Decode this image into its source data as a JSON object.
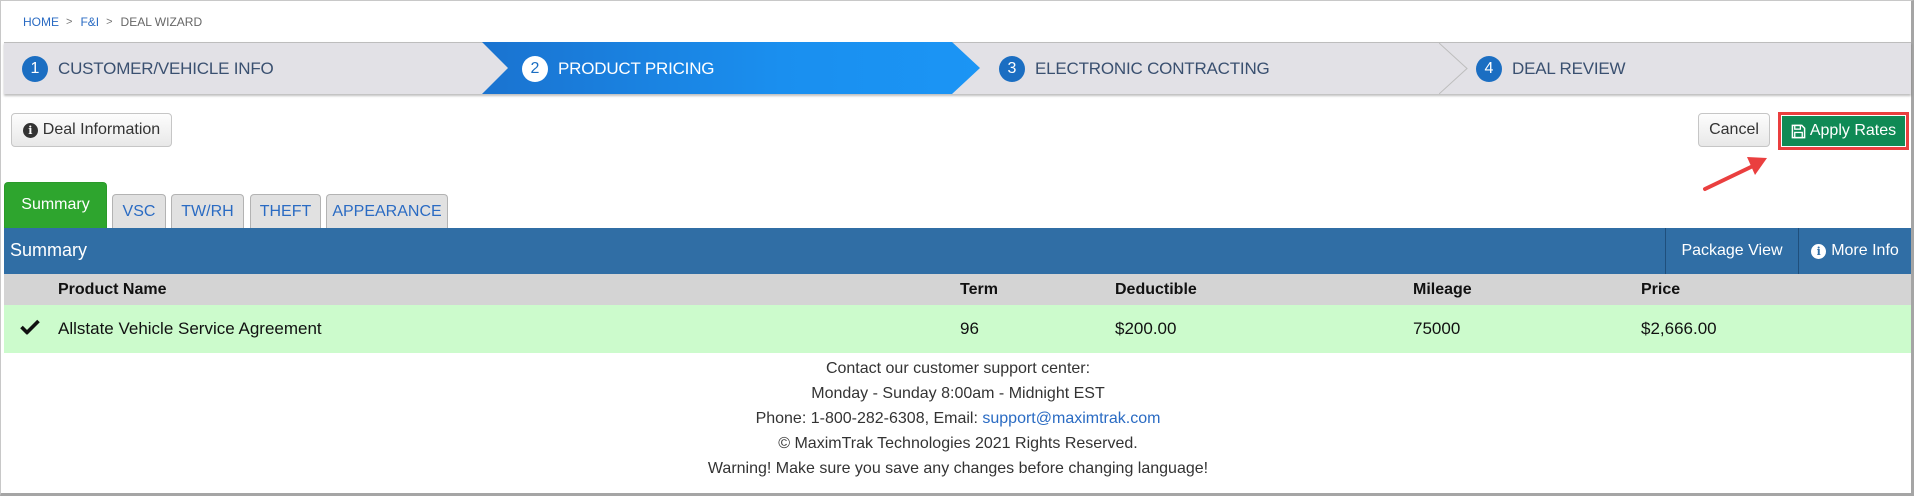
{
  "breadcrumb": {
    "items": [
      {
        "label": "HOME",
        "link": true
      },
      {
        "label": "F&I",
        "link": true
      },
      {
        "label": "DEAL WIZARD",
        "link": false
      }
    ],
    "separator": ">"
  },
  "wizard": {
    "steps": [
      {
        "number": "1",
        "label": "CUSTOMER/VEHICLE INFO",
        "active": false
      },
      {
        "number": "2",
        "label": "PRODUCT PRICING",
        "active": true
      },
      {
        "number": "3",
        "label": "ELECTRONIC CONTRACTING",
        "active": false
      },
      {
        "number": "4",
        "label": "DEAL REVIEW",
        "active": false
      }
    ]
  },
  "toolbar": {
    "deal_info_label": "Deal Information",
    "cancel_label": "Cancel",
    "apply_rates_label": "Apply Rates"
  },
  "tabs": [
    {
      "label": "Summary",
      "active": true
    },
    {
      "label": "VSC",
      "active": false
    },
    {
      "label": "TW/RH",
      "active": false
    },
    {
      "label": "THEFT",
      "active": false
    },
    {
      "label": "APPEARANCE",
      "active": false
    }
  ],
  "panel": {
    "title": "Summary",
    "package_view_label": "Package View",
    "more_info_label": "More Info"
  },
  "table": {
    "columns": [
      "Product Name",
      "Term",
      "Deductible",
      "Mileage",
      "Price"
    ],
    "rows": [
      {
        "selected": true,
        "product_name": "Allstate Vehicle Service Agreement",
        "term": "96",
        "deductible": "$200.00",
        "mileage": "75000",
        "price": "$2,666.00"
      }
    ]
  },
  "footer": {
    "line1": "Contact our customer support center:",
    "line2": "Monday - Sunday 8:00am - Midnight EST",
    "phone_prefix": "Phone: 1-800-282-6308, Email: ",
    "email": "support@maximtrak.com",
    "line4": "© MaximTrak Technologies 2021 Rights Reserved.",
    "line5": "Warning! Make sure you save any changes before changing language!"
  },
  "colors": {
    "active_step": "#1a8fef",
    "apply_button": "#0f8a55",
    "highlight_border": "#ea3f3f",
    "panel_header": "#306ea5",
    "active_tab": "#2ea52e",
    "selected_row": "#ccfbcc"
  }
}
